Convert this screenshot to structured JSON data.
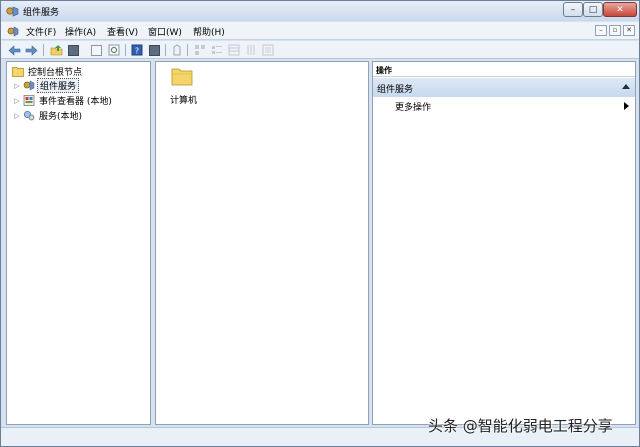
{
  "window": {
    "title": "组件服务",
    "controls": {
      "minimize": "–",
      "maximize": "□",
      "close": "✕"
    }
  },
  "menubar": {
    "items": [
      "文件(F)",
      "操作(A)",
      "查看(V)",
      "窗口(W)",
      "帮助(H)"
    ],
    "mdi": {
      "minimize": "–",
      "restore": "▫",
      "close": "✕"
    }
  },
  "toolbar": {
    "buttons": [
      "back-icon",
      "forward-icon",
      "up-icon",
      "show-tree-icon",
      "properties-icon",
      "refresh-icon",
      "help-icon",
      "action-pane-icon",
      "new-window-icon",
      "large-icons-icon",
      "small-icons-icon",
      "list-icon",
      "details-icon",
      "configure-icon"
    ]
  },
  "tree": {
    "root": "控制台根节点",
    "items": [
      {
        "label": "组件服务",
        "selected": true,
        "icon": "component-services-icon"
      },
      {
        "label": "事件查看器 (本地)",
        "selected": false,
        "icon": "event-viewer-icon"
      },
      {
        "label": "服务(本地)",
        "selected": false,
        "icon": "services-icon"
      }
    ]
  },
  "list": {
    "items": [
      {
        "label": "计算机",
        "icon": "folder-icon"
      }
    ]
  },
  "actions": {
    "header": "操作",
    "group": "组件服务",
    "items": [
      "更多操作"
    ]
  },
  "colors": {
    "frame": "#d6e2f0",
    "title_bar": "#c9d8ec",
    "selection_border": "#555555",
    "action_group_bg": "#c8d9ee",
    "folder_yellow": "#f5d46a"
  },
  "watermark": "头条 @智能化弱电工程分享"
}
